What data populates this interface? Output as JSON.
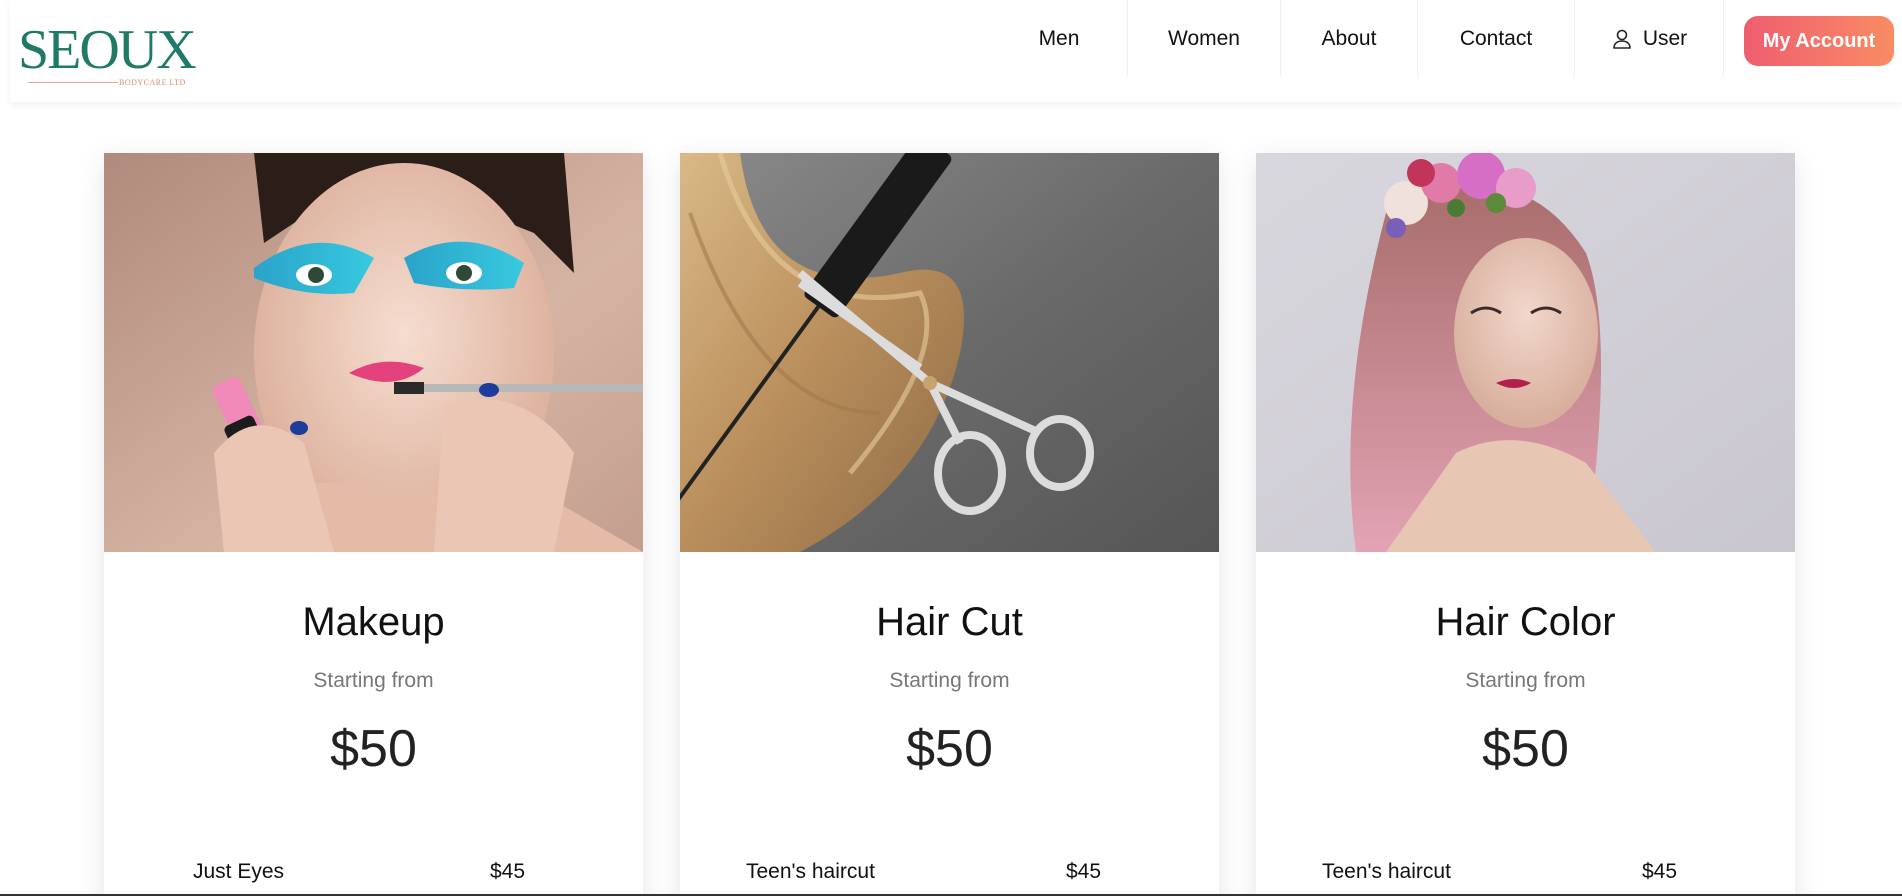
{
  "brand": {
    "name": "SEOUX",
    "tagline": "BODYCARE LTD"
  },
  "nav": {
    "items": [
      "Men",
      "Women",
      "About",
      "Contact"
    ],
    "user_label": "User",
    "account_button": "My Account"
  },
  "colors": {
    "brand_green": "#1f7a66",
    "brand_accent": "#d48d6c",
    "button_gradient_start": "#ef5d6f",
    "button_gradient_end": "#f98c63"
  },
  "cards": [
    {
      "title": "Makeup",
      "subtitle": "Starting from",
      "price": "$50",
      "items": [
        {
          "name": "Just Eyes",
          "price": "$45"
        }
      ]
    },
    {
      "title": "Hair Cut",
      "subtitle": "Starting from",
      "price": "$50",
      "items": [
        {
          "name": "Teen's haircut",
          "price": "$45"
        }
      ]
    },
    {
      "title": "Hair Color",
      "subtitle": "Starting from",
      "price": "$50",
      "items": [
        {
          "name": "Teen's haircut",
          "price": "$45"
        }
      ]
    }
  ]
}
